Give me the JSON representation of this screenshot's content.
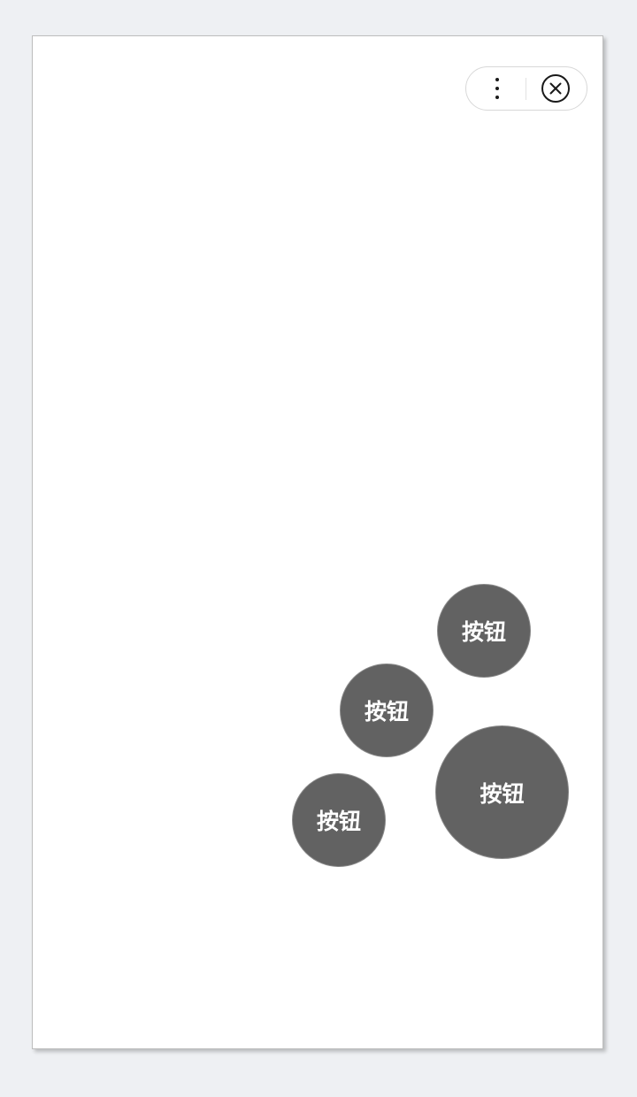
{
  "capsule": {
    "more_icon": "more-vertical-icon",
    "close_icon": "close-circle-icon"
  },
  "buttons": [
    {
      "label": "按钮"
    },
    {
      "label": "按钮"
    },
    {
      "label": "按钮"
    },
    {
      "label": "按钮"
    }
  ],
  "colors": {
    "background": "#eef0f3",
    "page": "#ffffff",
    "button_fill": "#626262",
    "button_text": "#ffffff"
  }
}
